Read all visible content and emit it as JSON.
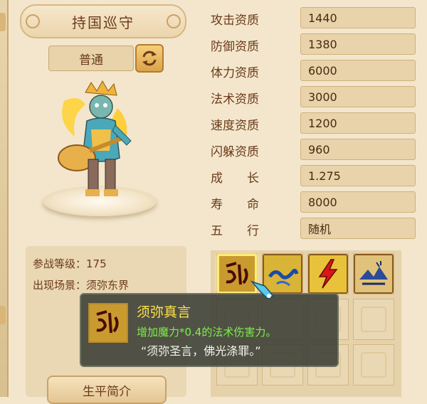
{
  "pet": {
    "name": "持国巡守",
    "grade": "普通"
  },
  "info": {
    "level_label": "参战等级：",
    "level_value": "175",
    "scene_label": "出现场景：",
    "scene_value": "须弥东界",
    "bio_button": "生平简介"
  },
  "stats": [
    {
      "label": "攻击资质",
      "value": "1440"
    },
    {
      "label": "防御资质",
      "value": "1380"
    },
    {
      "label": "体力资质",
      "value": "6000"
    },
    {
      "label": "法术资质",
      "value": "3000"
    },
    {
      "label": "速度资质",
      "value": "1200"
    },
    {
      "label": "闪躲资质",
      "value": "960"
    },
    {
      "label": "成　　长",
      "value": "1.275"
    },
    {
      "label": "寿　　命",
      "value": "8000"
    },
    {
      "label": "五　　行",
      "value": "随机"
    }
  ],
  "skills": [
    {
      "icon": "sumeru-rune-icon"
    },
    {
      "icon": "blue-wave-icon"
    },
    {
      "icon": "lightning-icon"
    },
    {
      "icon": "ice-landscape-icon"
    }
  ],
  "tooltip": {
    "name": "须弥真言",
    "effect": "增加魔力*0.4的法术伤害力。",
    "quote": "“须弥圣言，佛光涤罪。”"
  },
  "colors": {
    "background": "#f3e6cc",
    "text": "#6b3a1a",
    "tooltip_name": "#ffe24a",
    "tooltip_effect": "#7df04a"
  }
}
